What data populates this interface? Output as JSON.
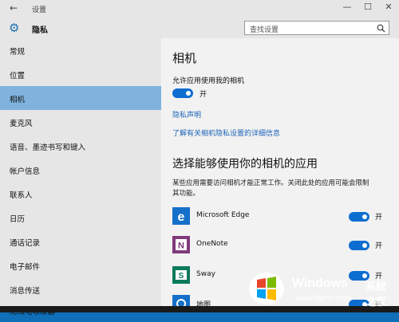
{
  "window": {
    "title": "设置",
    "back_glyph": "←",
    "minimize_glyph": "—",
    "maximize_glyph": "☐",
    "close_glyph": "✕"
  },
  "header": {
    "title": "隐私",
    "icon": "gear-icon",
    "search_placeholder": "查找设置",
    "search_icon": "search-icon"
  },
  "sidebar": {
    "items": [
      {
        "label": "常规"
      },
      {
        "label": "位置"
      },
      {
        "label": "相机",
        "active": true
      },
      {
        "label": "麦克风"
      },
      {
        "label": "语音、墨迹书写和键入"
      },
      {
        "label": "帐户信息"
      },
      {
        "label": "联系人"
      },
      {
        "label": "日历"
      },
      {
        "label": "通话记录"
      },
      {
        "label": "电子邮件"
      },
      {
        "label": "消息传送"
      },
      {
        "label": "无线电收发器"
      }
    ]
  },
  "main": {
    "title": "相机",
    "allow_label": "允许应用使用我的相机",
    "allow_state": "开",
    "privacy_link": "隐私声明",
    "learn_link": "了解有关相机隐私设置的详细信息",
    "apps_title": "选择能够使用你的相机的应用",
    "apps_desc": "某些应用需要访问相机才能正常工作。关闭此处的应用可能会限制其功能。",
    "apps": [
      {
        "name": "Microsoft Edge",
        "state": "开",
        "icon": "edge-icon",
        "color": "#1570c9"
      },
      {
        "name": "OneNote",
        "state": "开",
        "icon": "onenote-icon",
        "color": "#80397b"
      },
      {
        "name": "Sway",
        "state": "开",
        "icon": "sway-icon",
        "color": "#0b7a5c"
      },
      {
        "name": "地图",
        "state": "开",
        "icon": "maps-icon",
        "color": "#1570c9"
      }
    ]
  },
  "colors": {
    "accent": "#0e6ed0",
    "link": "#1a63b8",
    "sidebar_active": "#7fb2dc"
  },
  "watermark": {
    "brand": "Windows",
    "brand_cn": "系统之家",
    "url": "www.bjjmlv.com"
  }
}
